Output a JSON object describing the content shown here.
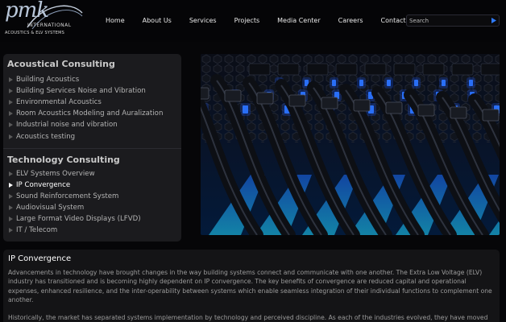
{
  "brand": {
    "logo_text": "pmk",
    "logo_line1": "INTERNATIONAL",
    "logo_line2": "ACOUSTICS & ELV SYSTEMS"
  },
  "nav": {
    "items": [
      {
        "label": "Home"
      },
      {
        "label": "About Us"
      },
      {
        "label": "Services"
      },
      {
        "label": "Projects"
      },
      {
        "label": "Media Center"
      },
      {
        "label": "Careers"
      },
      {
        "label": "Contacts"
      }
    ]
  },
  "search": {
    "value": "Search",
    "go_icon": "arrow-right-icon"
  },
  "sidebar": {
    "sections": [
      {
        "title": "Acoustical Consulting",
        "items": [
          {
            "label": "Building Acoustics"
          },
          {
            "label": "Building Services Noise and Vibration"
          },
          {
            "label": "Environmental Acoustics"
          },
          {
            "label": "Room Acoustics Modeling and Auralization"
          },
          {
            "label": "Industrial noise and vibration"
          },
          {
            "label": "Acoustics testing"
          }
        ]
      },
      {
        "title": "Technology Consulting",
        "items": [
          {
            "label": "ELV Systems Overview"
          },
          {
            "label": "IP Convergence",
            "active": true
          },
          {
            "label": "Sound Reinforcement System"
          },
          {
            "label": "Audiovisual System"
          },
          {
            "label": "Large Format Video Displays (LFVD)"
          },
          {
            "label": "IT / Telecom"
          }
        ]
      }
    ]
  },
  "hero": {
    "icon": "network-cables-image"
  },
  "content": {
    "title": "IP Convergence",
    "paragraphs": [
      "Advancements in technology have brought changes in the way building systems connect and communicate with one another. The Extra Low Voltage (ELV) industry has transitioned and is becoming highly dependent on IP convergence. The key benefits of convergence are reduced capital and operational expenses, enhanced resilience, and the inter-operability between systems which enable seamless integration of their individual functions to complement one another.",
      "Historically, the market has separated systems implementation by technology and perceived discipline. As each of the industries evolved, they have moved away from proprietary networks, embraced the capabilities of IP and implemented their systems on separate LANs."
    ]
  },
  "colors": {
    "background": "#060608",
    "panel": "#1b1b1e",
    "accent_blue": "#2f7bff",
    "glow_cyan": "#19c8ff"
  }
}
